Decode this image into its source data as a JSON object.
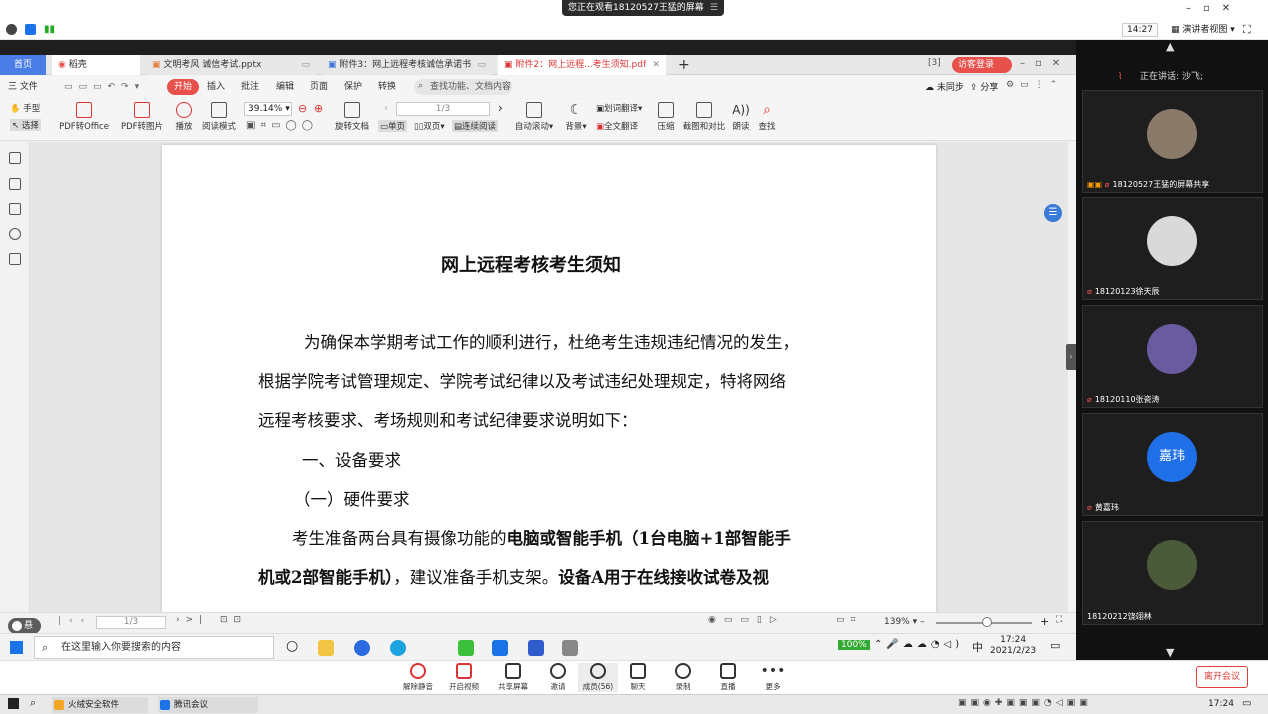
{
  "meeting": {
    "watching_banner": "您正在观看18120527王猛的屏幕",
    "time": "14:27",
    "view_mode": "演讲者视图",
    "speaking": "正在讲话: 沙飞;"
  },
  "wps": {
    "tabs": [
      {
        "label": "首页"
      },
      {
        "label": "稻壳"
      },
      {
        "label": "文明考风 诚信考试.pptx"
      },
      {
        "label": "附件3：网上远程考核诚信承诺书"
      },
      {
        "label": "附件2：网上远程...考生须知.pdf"
      }
    ],
    "visitor_login": "访客登录",
    "menu": {
      "file": "三 文件",
      "start": "开始",
      "items": [
        "插入",
        "批注",
        "编辑",
        "页面",
        "保护",
        "转换"
      ],
      "search_placeholder": "查找功能、文档内容",
      "unsync": "未同步",
      "share": "分享"
    },
    "ribbon": {
      "hand": "手型",
      "select": "选择",
      "pdf_to_office": "PDF转Office",
      "pdf_to_image": "PDF转图片",
      "play": "播放",
      "read_mode": "阅读模式",
      "zoom": "39.14%",
      "page": "1/3",
      "rotate": "旋转文档",
      "single": "单页",
      "double": "双页",
      "continuous": "连续阅读",
      "auto_scroll": "自动滚动",
      "background": "背景",
      "word_translate": "划词翻译",
      "full_translate": "全文翻译",
      "compress": "压缩",
      "screenshot": "截图和对比",
      "read_aloud": "朗读",
      "find": "查找"
    },
    "document": {
      "title": "网上远程考核考生须知",
      "p1": "为确保本学期考试工作的顺利进行，杜绝考生违规违纪情况的发生，",
      "p2": "根据学院考试管理规定、学院考试纪律以及考试违纪处理规定，特将网络",
      "p3": "远程考核要求、考场规则和考试纪律要求说明如下：",
      "h1": "一、设备要求",
      "h2": "（一）硬件要求",
      "p4a": "考生准备两台具有摄像功能的",
      "p4b": "电脑或智能手机（1台电脑+1部智能手",
      "p5a": "机或2部智能手机）",
      "p5b": "，建议准备手机支架。",
      "p5c": "设备A用于在线接收试卷及视"
    },
    "status": {
      "page": "1/3",
      "zoom": "139%",
      "dock": "悬"
    }
  },
  "win_taskbar": {
    "search_placeholder": "在这里输入你要搜索的内容",
    "battery": "100%",
    "ime": "中",
    "time": "17:24",
    "date": "2021/2/23"
  },
  "participants": [
    {
      "name": "18120527王猛的屏幕共享",
      "avatar_color": "#8a7a6a"
    },
    {
      "name": "18120123徐天辰",
      "avatar_color": "#d9d9d9"
    },
    {
      "name": "18120110张瓷涛",
      "avatar_color": "#6a5aa0"
    },
    {
      "name": "黄嘉玮",
      "avatar_text": "嘉玮",
      "avatar_color": "#1e6fe8"
    },
    {
      "name": "18120212饶翊林",
      "avatar_color": "#4a5a3a"
    }
  ],
  "controls": {
    "mute": "解除静音",
    "video": "开启视频",
    "share_screen": "共享屏幕",
    "invite": "邀请",
    "members": "成员(56)",
    "chat": "聊天",
    "record": "录制",
    "live": "直播",
    "more": "更多",
    "leave": "离开会议"
  },
  "host_taskbar": {
    "app1": "火绒安全软件",
    "app2": "腾讯会议",
    "time": "17:24"
  }
}
